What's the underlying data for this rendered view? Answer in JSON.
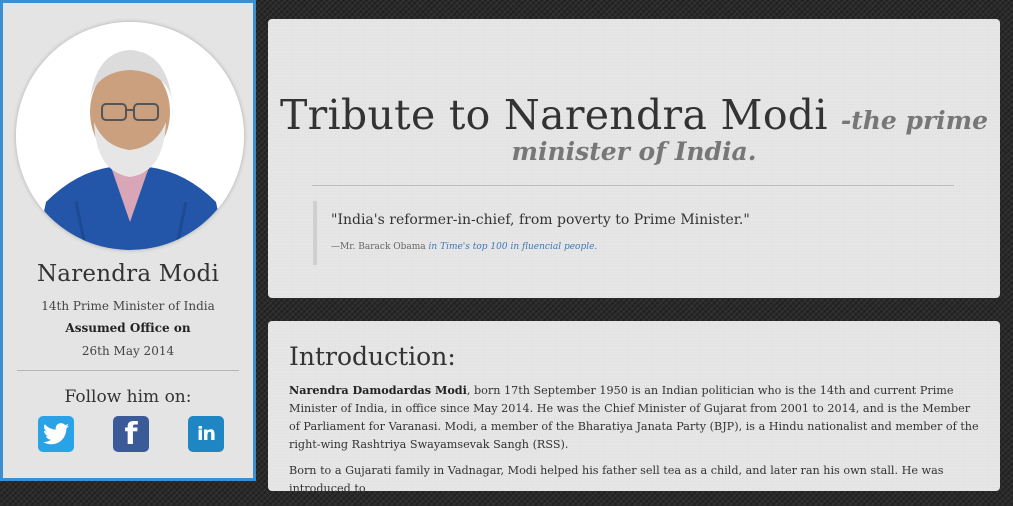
{
  "sidebar": {
    "name": "Narendra Modi",
    "role": "14th Prime Minister of India",
    "office_label": "Assumed Office on",
    "office_date": "26th May 2014",
    "follow_label": "Follow him on:",
    "social": [
      {
        "name": "twitter",
        "icon": "twitter-icon",
        "color": "#2aa3e6"
      },
      {
        "name": "facebook",
        "icon": "facebook-icon",
        "glyph": "f",
        "color": "#3b5a98"
      },
      {
        "name": "linkedin",
        "icon": "linkedin-icon",
        "glyph": "in",
        "color": "#1e86c3"
      }
    ]
  },
  "header": {
    "title": "Tribute to Narendra Modi",
    "subtitle_part1": "-the prime",
    "subtitle_part2": "minister of India."
  },
  "quote": {
    "text": "\"India's reformer-in-chief, from poverty to Prime Minister.\"",
    "source": "—Mr. Barack Obama ",
    "cite": "in Time's top 100 in fluencial people."
  },
  "intro": {
    "heading": "Introduction:",
    "lead_name": "Narendra Damodardas Modi",
    "para1_rest": ", born 17th September 1950 is an Indian politician who is the 14th and current Prime Minister of India, in office since May 2014. He was the Chief Minister of Gujarat from 2001 to 2014, and is the Member of Parliament for Varanasi. Modi, a member of the Bharatiya Janata Party (BJP), is a Hindu nationalist and member of the right-wing Rashtriya Swayamsevak Sangh (RSS).",
    "para2": "Born to a Gujarati family in Vadnagar, Modi helped his father sell tea as a child, and later ran his own stall. He was introduced to"
  }
}
